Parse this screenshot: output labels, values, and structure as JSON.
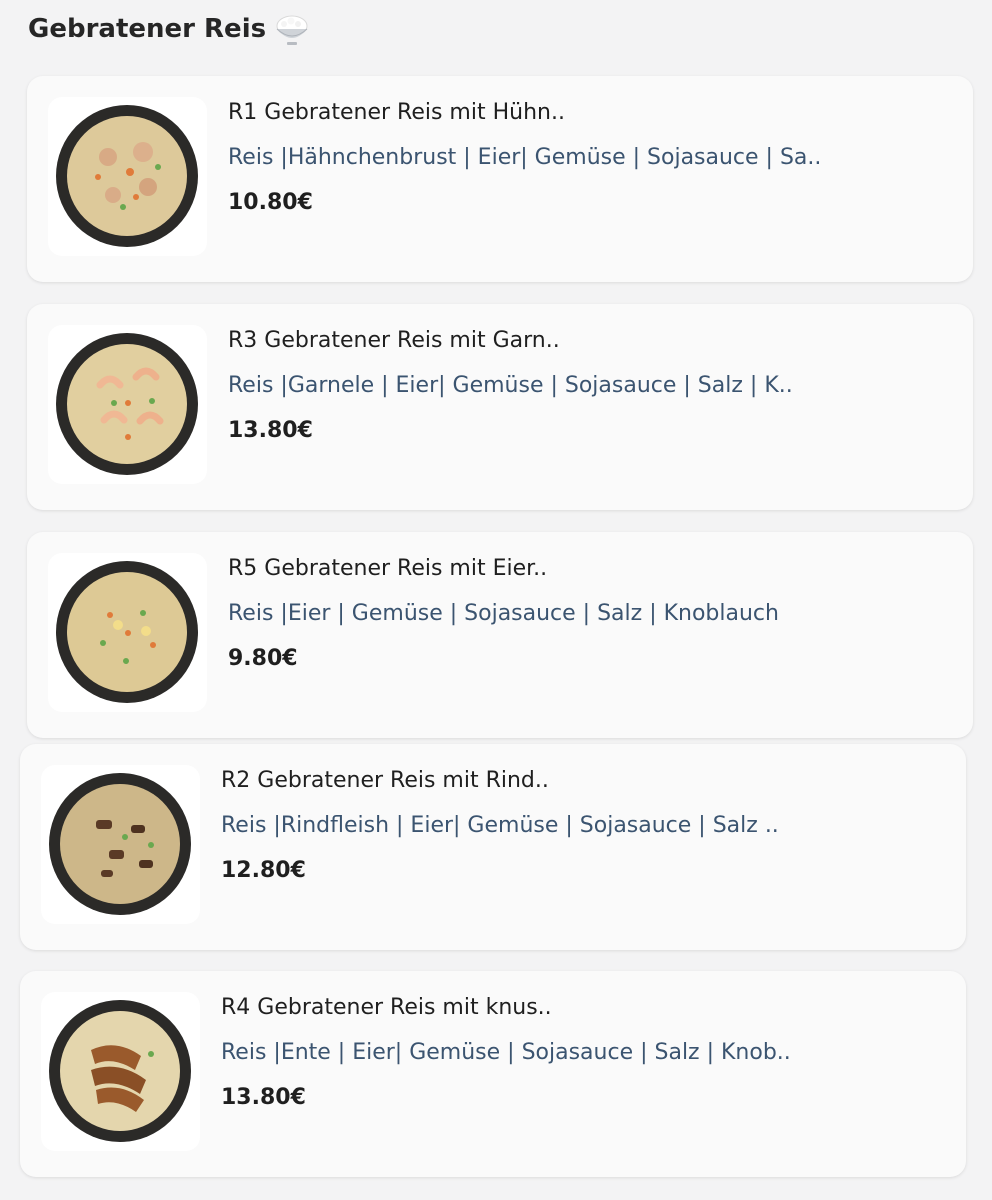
{
  "section": {
    "title": "Gebratener Reis",
    "icon": "rice-bowl-icon"
  },
  "items": [
    {
      "name": "R1 Gebratener Reis mit Hühn..",
      "ingredients": "Reis |Hähnchenbrust | Eier| Gemüse | Sojasauce | Sa..",
      "price": "10.80€",
      "image": "fried-rice-chicken-image"
    },
    {
      "name": "R3 Gebratener Reis mit Garn..",
      "ingredients": "Reis |Garnele | Eier| Gemüse | Sojasauce | Salz | K..",
      "price": "13.80€",
      "image": "fried-rice-shrimp-image"
    },
    {
      "name": "R5 Gebratener Reis mit Eier..",
      "ingredients": "Reis |Eier | Gemüse | Sojasauce | Salz | Knoblauch",
      "price": "9.80€",
      "image": "fried-rice-egg-image"
    },
    {
      "name": "R2 Gebratener Reis mit Rind..",
      "ingredients": "Reis |Rindfleish | Eier| Gemüse | Sojasauce | Salz ..",
      "price": "12.80€",
      "image": "fried-rice-beef-image"
    },
    {
      "name": "R4 Gebratener Reis mit knus..",
      "ingredients": "Reis |Ente | Eier| Gemüse | Sojasauce | Salz | Knob..",
      "price": "13.80€",
      "image": "fried-rice-duck-image"
    }
  ]
}
